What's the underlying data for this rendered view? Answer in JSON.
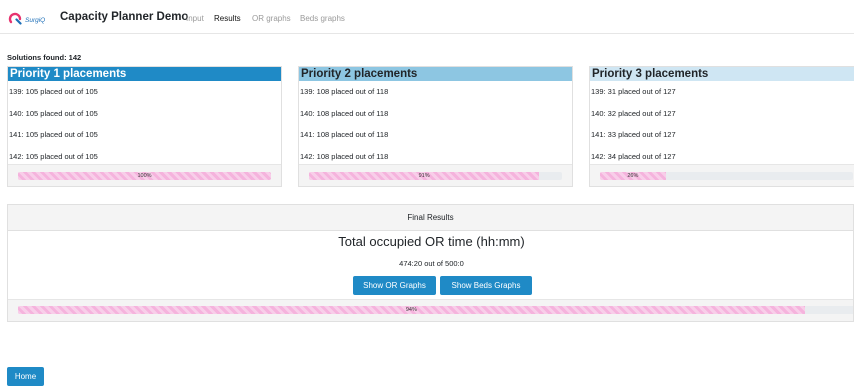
{
  "nav": {
    "logo_text": "SurgiQ",
    "brand": "Capacity Planner Demo",
    "links": [
      {
        "label": "Input",
        "state": "enabled"
      },
      {
        "label": "Results",
        "state": "active"
      },
      {
        "label": "OR graphs",
        "state": "disabled"
      },
      {
        "label": "Beds graphs",
        "state": "disabled"
      }
    ]
  },
  "solutions_found": "Solutions found: 142",
  "priorities": [
    {
      "title": "Priority 1 placements",
      "rows": [
        "139: 105 placed out of 105",
        "140: 105 placed out of 105",
        "141: 105 placed out of 105",
        "142: 105 placed out of 105"
      ],
      "progress_label": "100%",
      "progress": 1.0
    },
    {
      "title": "Priority 2 placements",
      "rows": [
        "139: 108 placed out of 118",
        "140: 108 placed out of 118",
        "141: 108 placed out of 118",
        "142: 108 placed out of 118"
      ],
      "progress_label": "91%",
      "progress": 0.91
    },
    {
      "title": "Priority 3 placements",
      "rows": [
        "139: 31 placed out of 127",
        "140: 32 placed out of 127",
        "141: 33 placed out of 127",
        "142: 34 placed out of 127"
      ],
      "progress_label": "26%",
      "progress": 0.26
    }
  ],
  "final": {
    "header": "Final Results",
    "title": "Total occupied OR time (hh:mm)",
    "subtitle": "474:20 out of 500:0",
    "show_or_label": "Show OR Graphs",
    "show_beds_label": "Show Beds Graphs",
    "progress_label": "94%",
    "progress": 0.94
  },
  "home_label": "Home",
  "colors": {
    "primary": "#1f8ac6",
    "priority1_header": "#1f8ac6",
    "priority2_header": "#8dc6e2",
    "priority3_header": "#cfe6f3",
    "progress_bar": "#f5b3dd"
  }
}
